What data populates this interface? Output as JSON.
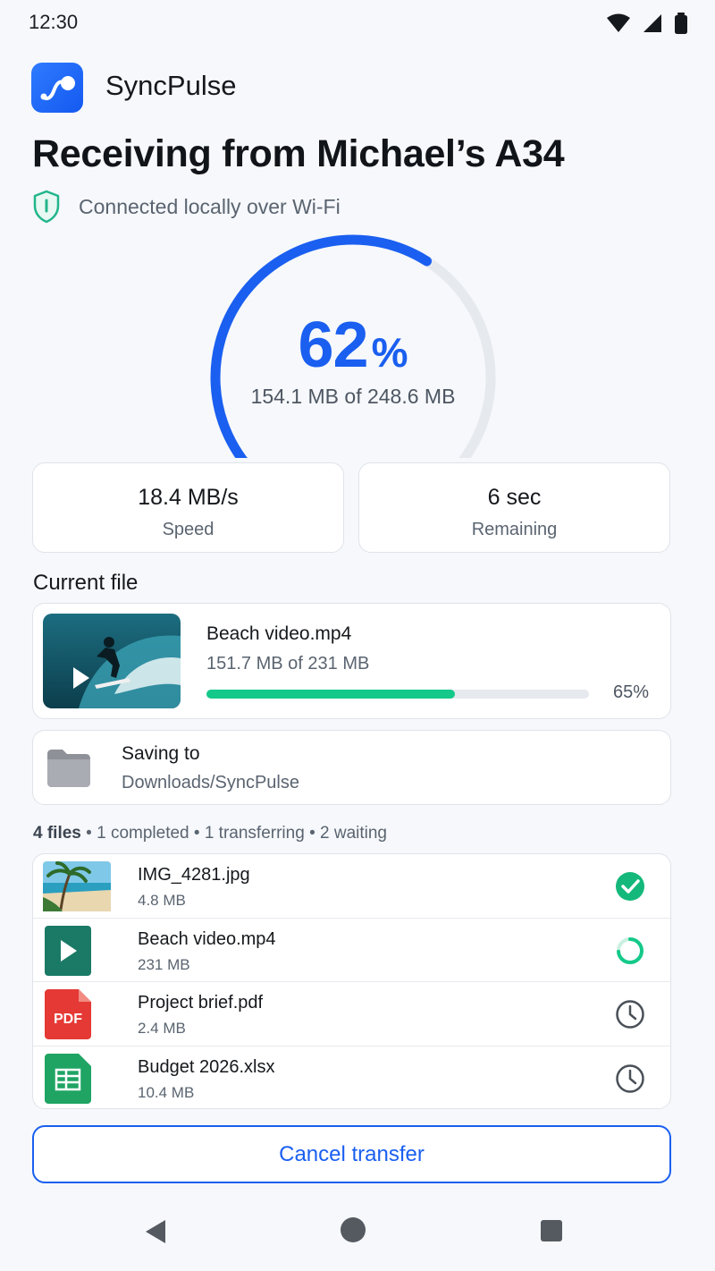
{
  "status_bar": {
    "time": "12:30",
    "icons": [
      "wifi-icon",
      "signal-icon",
      "battery-icon"
    ]
  },
  "app": {
    "name": "SyncPulse",
    "logo_icon": "pulse-logo-icon",
    "brand_color": "#1a5ff0"
  },
  "title": "Receiving from Michael’s A34",
  "connection": {
    "text": "Connected locally over Wi-Fi",
    "icon": "shield-icon",
    "color": "#22b58c"
  },
  "progress": {
    "percent_value": "62",
    "percent_sign": "%",
    "fraction": 0.62,
    "detail": "154.1 MB of 248.6 MB"
  },
  "stats": [
    {
      "value": "18.4 MB/s",
      "label": "Speed"
    },
    {
      "value": "6 sec",
      "label": "Remaining"
    }
  ],
  "current_file": {
    "section_title": "Current file",
    "name": "Beach video.mp4",
    "size": "151.7 MB of 231 MB",
    "percent": "65%",
    "fraction": 0.65
  },
  "saving": {
    "label": "Saving to",
    "path": "Downloads/SyncPulse",
    "icon": "folder-icon"
  },
  "summary": {
    "count": "4 files",
    "completed": "1 completed",
    "transferring": "1 transferring",
    "waiting": "2 waiting"
  },
  "files": [
    {
      "name": "IMG_4281.jpg",
      "size": "4.8 MB",
      "thumb_icon": "beach-photo-icon",
      "status": "completed",
      "status_icon": "check-circle-icon"
    },
    {
      "name": "Beach video.mp4",
      "size": "231 MB",
      "thumb_icon": "video-play-icon",
      "status": "transferring",
      "status_icon": "progress-ring-icon"
    },
    {
      "name": "Project brief.pdf",
      "size": "2.4 MB",
      "thumb_icon": "pdf-file-icon",
      "thumb_text": "PDF",
      "status": "waiting",
      "status_icon": "clock-icon"
    },
    {
      "name": "Budget 2026.xlsx",
      "size": "10.4 MB",
      "thumb_icon": "spreadsheet-icon",
      "status": "waiting",
      "status_icon": "clock-icon"
    }
  ],
  "cancel_label": "Cancel transfer",
  "colors": {
    "accent": "#1a5ff0",
    "success": "#14c98a",
    "track": "#e6e9ee"
  }
}
